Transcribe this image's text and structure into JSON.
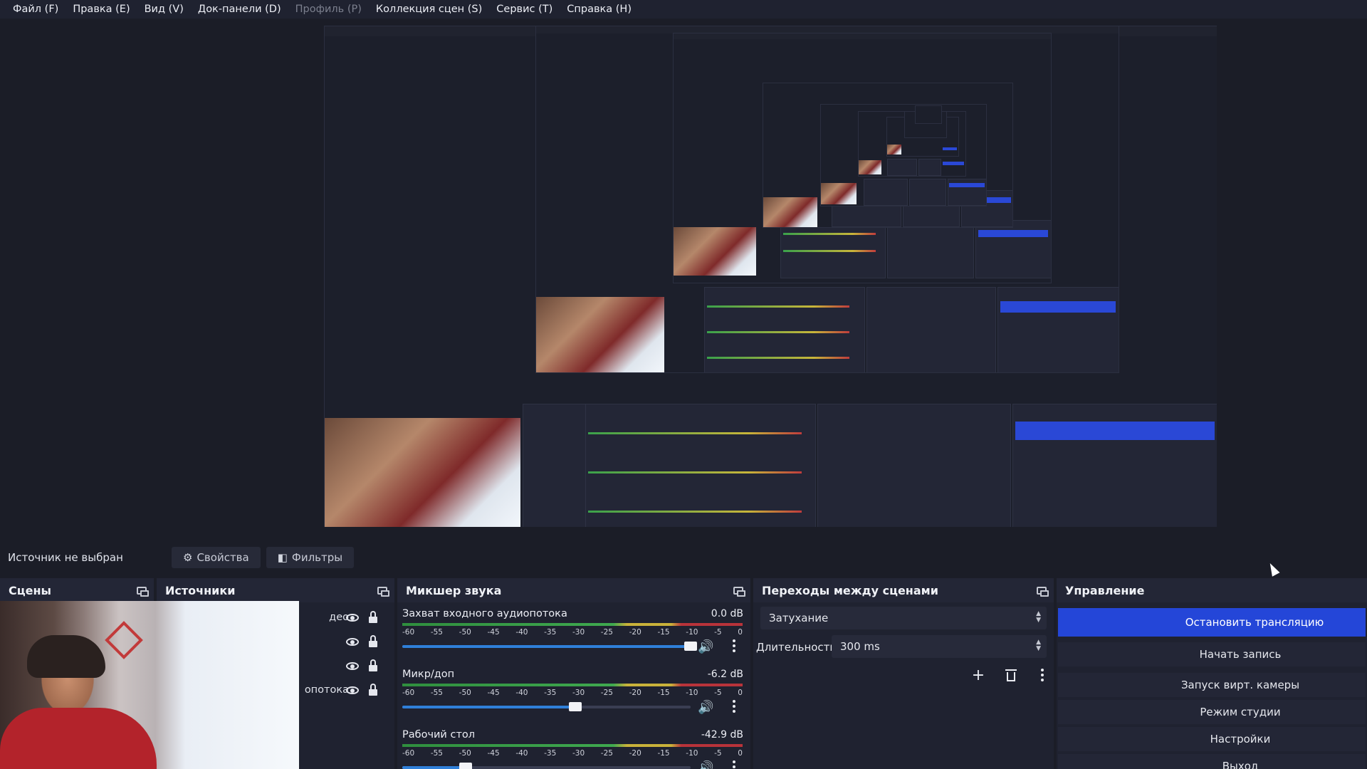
{
  "menu": [
    {
      "label": "Файл (F)",
      "disabled": false
    },
    {
      "label": "Правка (E)",
      "disabled": false
    },
    {
      "label": "Вид (V)",
      "disabled": false
    },
    {
      "label": "Док-панели (D)",
      "disabled": false
    },
    {
      "label": "Профиль (P)",
      "disabled": true
    },
    {
      "label": "Коллекция сцен (S)",
      "disabled": false
    },
    {
      "label": "Сервис (T)",
      "disabled": false
    },
    {
      "label": "Справка (H)",
      "disabled": false
    }
  ],
  "source_bar": {
    "no_source": "Источник не выбран",
    "properties": "Свойства",
    "filters": "Фильтры"
  },
  "docks": {
    "scenes": "Сцены",
    "sources": "Источники",
    "mixer": "Микшер звука",
    "transitions": "Переходы между сценами",
    "controls": "Управление"
  },
  "sources": [
    {
      "label": "део"
    },
    {
      "label": ""
    },
    {
      "label": ""
    },
    {
      "label": "опотока"
    }
  ],
  "mixer": {
    "ticks": [
      "-60",
      "-55",
      "-50",
      "-45",
      "-40",
      "-35",
      "-30",
      "-25",
      "-20",
      "-15",
      "-10",
      "-5",
      "0"
    ],
    "channels": [
      {
        "name": "Захват входного аудиопотока",
        "db": "0.0 dB",
        "volume": 1.0
      },
      {
        "name": "Микр/доп",
        "db": "-6.2 dB",
        "volume": 0.6
      },
      {
        "name": "Рабочий стол",
        "db": "-42.9 dB",
        "volume": 0.22
      }
    ]
  },
  "transitions": {
    "selected": "Затухание",
    "duration_label": "Длительность",
    "duration_value": "300 ms"
  },
  "controls": [
    "Остановить трансляцию",
    "Начать запись",
    "Запуск вирт. камеры",
    "Режим студии",
    "Настройки",
    "Выход"
  ],
  "colors": {
    "accent": "#2446d8",
    "background": "#1b1d27",
    "panel": "#1f2230"
  }
}
